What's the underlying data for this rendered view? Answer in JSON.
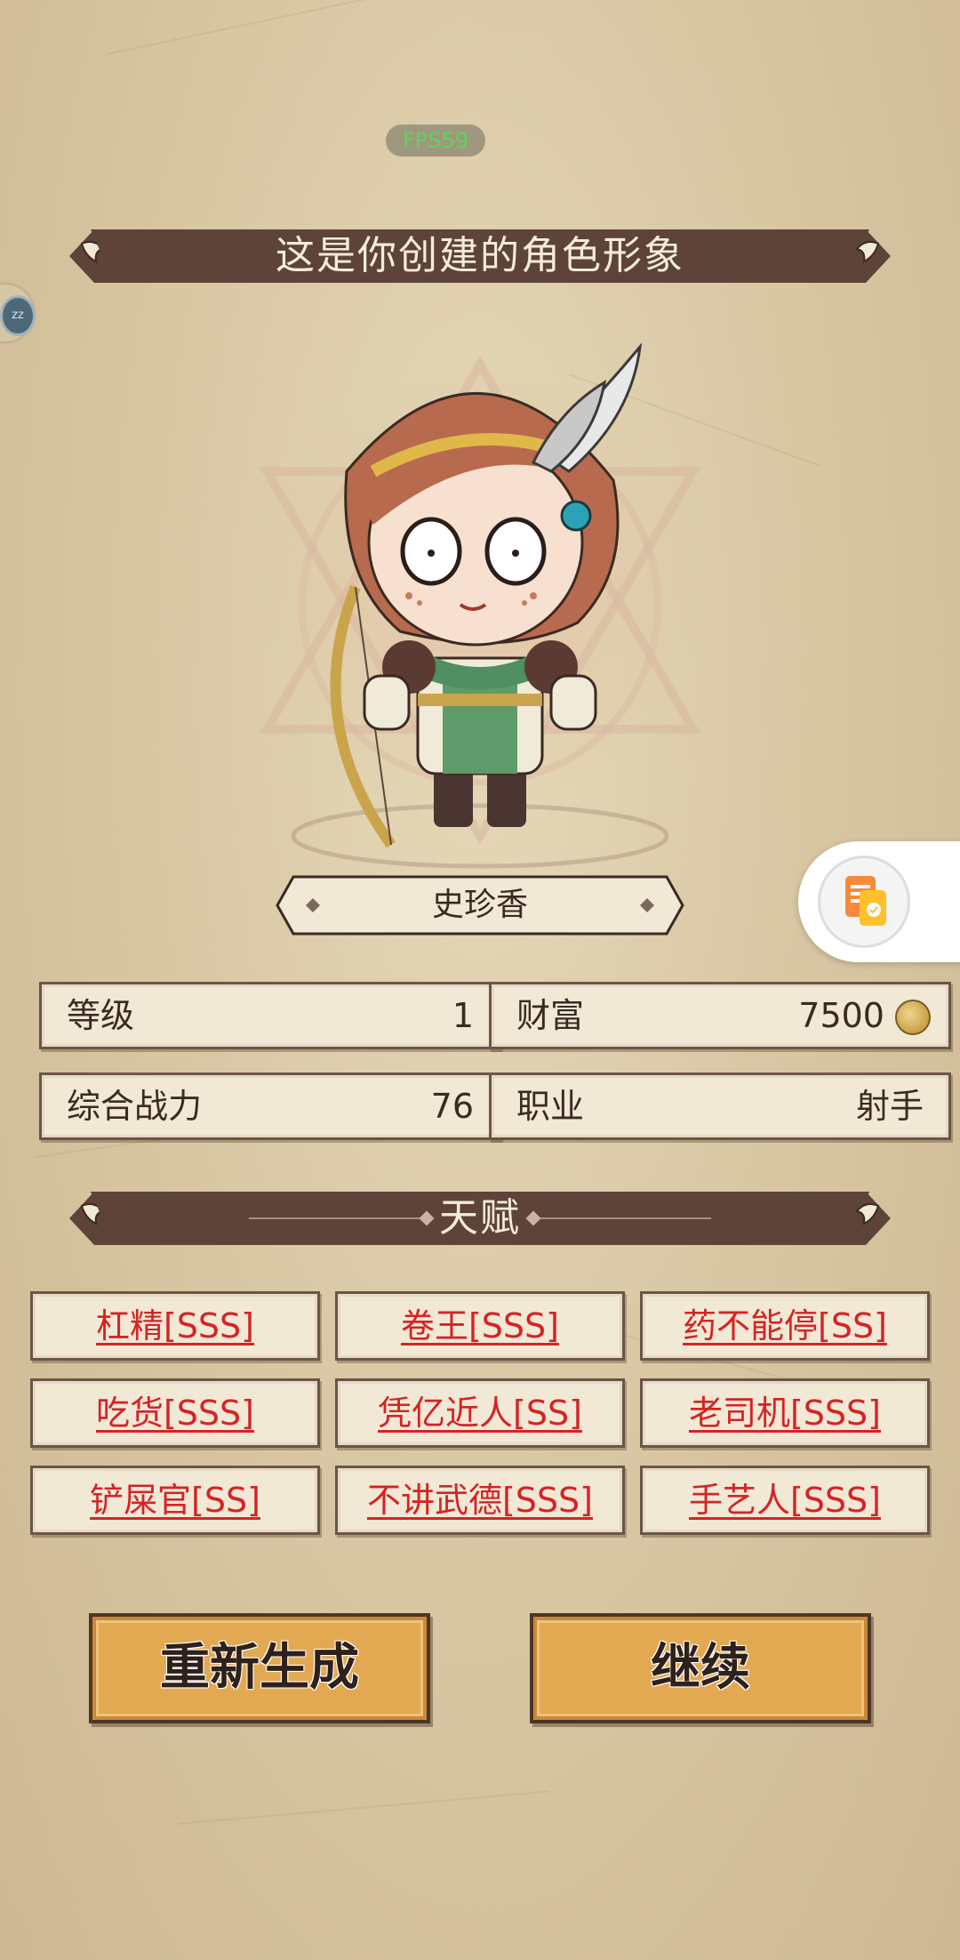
{
  "status": {
    "fps": "FPS59",
    "side_badge": "zz"
  },
  "header": {
    "title": "这是你创建的角色形象"
  },
  "character": {
    "name": "史珍香"
  },
  "stats": [
    {
      "label": "等级",
      "value": "1"
    },
    {
      "label": "财富",
      "value": "7500"
    },
    {
      "label": "综合战力",
      "value": "76"
    },
    {
      "label": "职业",
      "value": "射手"
    }
  ],
  "talent_section": {
    "title": "天赋"
  },
  "talents": [
    "杠精[SSS]",
    "卷王[SSS]",
    "药不能停[SS]",
    "吃货[SSS]",
    "凭亿近人[SS]",
    "老司机[SSS]",
    "铲屎官[SS]",
    "不讲武德[SSS]",
    "手艺人[SSS]"
  ],
  "actions": {
    "regenerate": "重新生成",
    "continue": "继续"
  },
  "colors": {
    "banner": "#5e4338",
    "button": "#e2a952",
    "talent_text": "#d42424",
    "card": "#f1e8d6"
  }
}
